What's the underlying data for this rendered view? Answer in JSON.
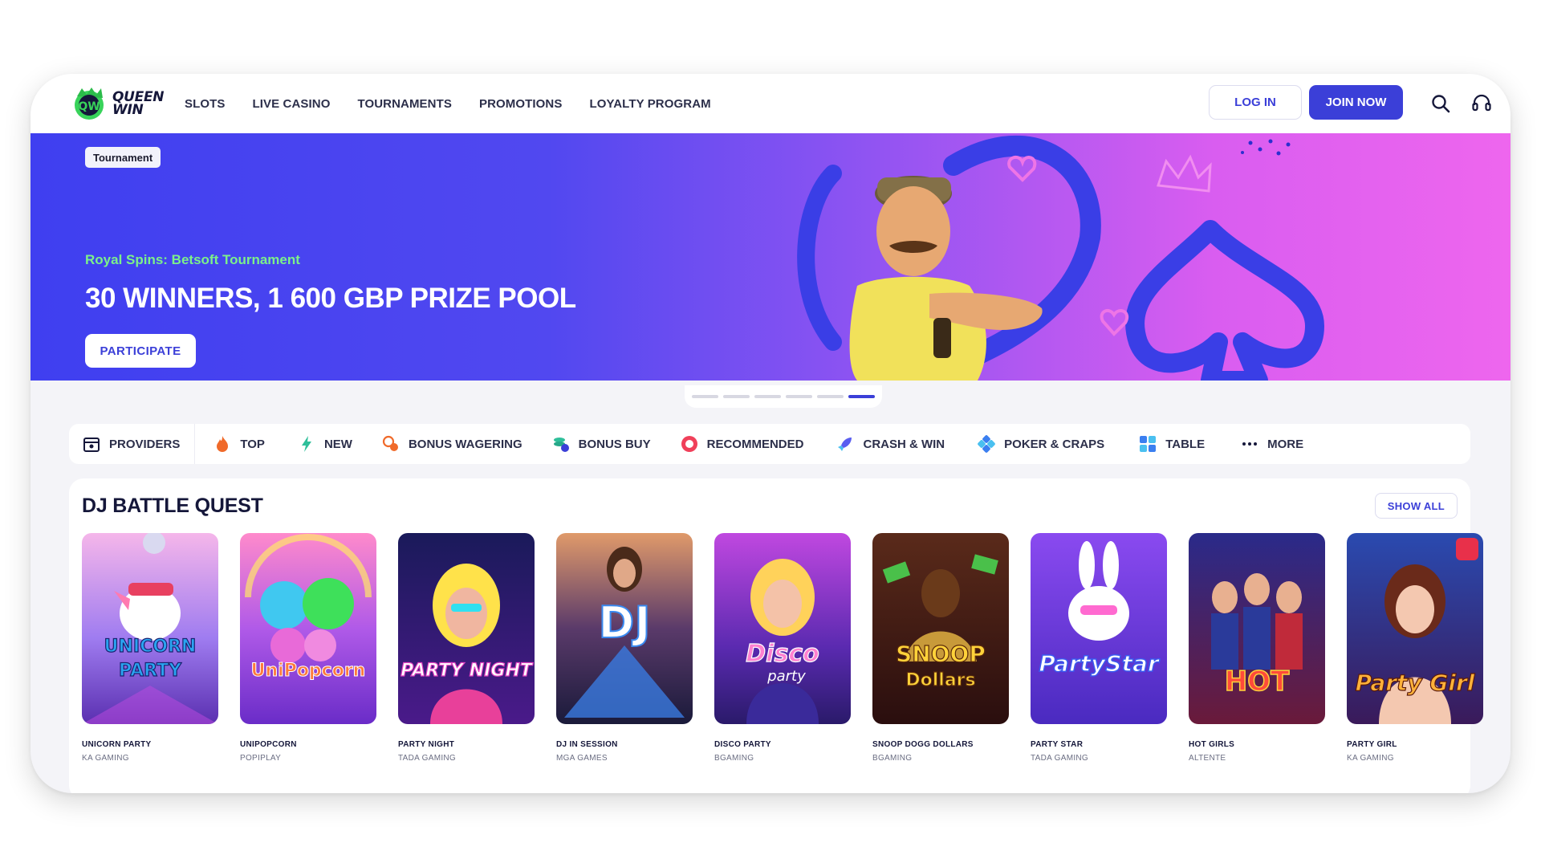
{
  "brand": {
    "name_line1": "QUEEN",
    "name_line2": "WIN"
  },
  "nav": [
    "SLOTS",
    "LIVE CASINO",
    "TOURNAMENTS",
    "PROMOTIONS",
    "LOYALTY PROGRAM"
  ],
  "auth": {
    "login": "LOG IN",
    "join": "JOIN NOW"
  },
  "hero": {
    "badge": "Tournament",
    "subtitle": "Royal Spins: Betsoft Tournament",
    "title": "30 WINNERS, 1 600 GBP PRIZE POOL",
    "cta": "PARTICIPATE",
    "slides_total": 6,
    "active_slide": 6
  },
  "categories": [
    {
      "label": "PROVIDERS",
      "icon": "providers-icon"
    },
    {
      "label": "TOP",
      "icon": "fire-icon"
    },
    {
      "label": "NEW",
      "icon": "lightning-icon"
    },
    {
      "label": "BONUS WAGERING",
      "icon": "bonus-wagering-icon"
    },
    {
      "label": "BONUS BUY",
      "icon": "coins-icon"
    },
    {
      "label": "RECOMMENDED",
      "icon": "recommended-icon"
    },
    {
      "label": "CRASH & WIN",
      "icon": "rocket-icon"
    },
    {
      "label": "POKER & CRAPS",
      "icon": "poker-icon"
    },
    {
      "label": "TABLE",
      "icon": "table-icon"
    },
    {
      "label": "MORE",
      "icon": "more-icon"
    }
  ],
  "section": {
    "title": "DJ BATTLE QUEST",
    "show_all": "SHOW ALL",
    "games": [
      {
        "name": "UNICORN PARTY",
        "provider": "KA GAMING",
        "art_text": "UNICORN PARTY"
      },
      {
        "name": "UNIPOPCORN",
        "provider": "POPIPLAY",
        "art_text": "UniPopcorn"
      },
      {
        "name": "PARTY NIGHT",
        "provider": "TADA GAMING",
        "art_text": "PARTY NIGHT"
      },
      {
        "name": "DJ IN SESSION",
        "provider": "MGA GAMES",
        "art_text": "DJ"
      },
      {
        "name": "DISCO PARTY",
        "provider": "BGAMING",
        "art_text": "Disco party"
      },
      {
        "name": "SNOOP DOGG DOLLARS",
        "provider": "BGAMING",
        "art_text": "SNOOP DOGG Dollars"
      },
      {
        "name": "PARTY STAR",
        "provider": "TADA GAMING",
        "art_text": "PartyStar"
      },
      {
        "name": "HOT GIRLS",
        "provider": "ALTENTE",
        "art_text": "HOT GIRLS"
      },
      {
        "name": "PARTY GIRL",
        "provider": "KA GAMING",
        "art_text": "Party Girl"
      }
    ]
  },
  "colors": {
    "accent": "#3b3fd8",
    "hero_left": "#3f3ff0",
    "hero_right": "#ee66ee",
    "highlight_green": "#7cf08a"
  }
}
